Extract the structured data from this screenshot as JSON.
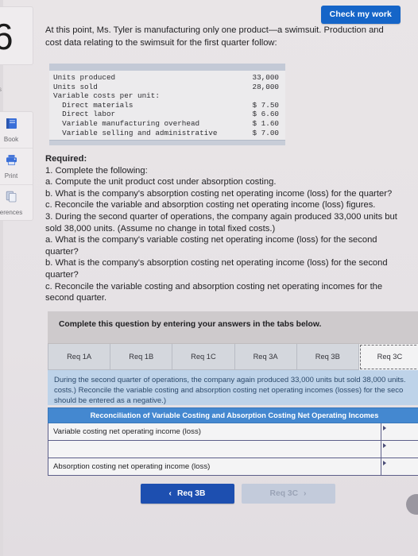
{
  "sidebar": {
    "question_number": "6",
    "question_sub": "s",
    "tools": [
      {
        "label": "Book",
        "icon": "book-icon"
      },
      {
        "label": "Print",
        "icon": "printer-icon"
      },
      {
        "label": "erences",
        "icon": "references-icon"
      }
    ]
  },
  "header": {
    "check_my_work": "Check my work"
  },
  "intro": "At this point, Ms. Tyler is manufacturing only one product—a swimsuit. Production and cost data relating to the swimsuit for the first quarter follow:",
  "data_table": {
    "rows": [
      {
        "label": "Units produced",
        "value": "33,000"
      },
      {
        "label": "Units sold",
        "value": "28,000"
      },
      {
        "label": "Variable costs per unit:",
        "value": ""
      },
      {
        "label": "  Direct materials",
        "value": "$ 7.50"
      },
      {
        "label": "  Direct labor",
        "value": "$ 6.60"
      },
      {
        "label": "  Variable manufacturing overhead",
        "value": "$ 1.60"
      },
      {
        "label": "  Variable selling and administrative",
        "value": "$ 7.00"
      }
    ]
  },
  "required": {
    "heading": "Required:",
    "lines": [
      "1. Complete the following:",
      "a. Compute the unit product cost under absorption costing.",
      "b. What is the company's absorption costing net operating income (loss) for the quarter?",
      "c. Reconcile the variable and absorption costing net operating income (loss) figures.",
      "3. During the second quarter of operations, the company again produced 33,000 units but sold 38,000 units. (Assume no change in total fixed costs.)",
      "a. What is the company's variable costing net operating income (loss) for the second quarter?",
      "b. What is the company's absorption costing net operating income (loss) for the second quarter?",
      "c. Reconcile the variable costing and absorption costing net operating incomes for the second quarter."
    ]
  },
  "panel": {
    "banner": "Complete this question by entering your answers in the tabs below.",
    "tabs": [
      {
        "label": "Req 1A",
        "active": false
      },
      {
        "label": "Req 1B",
        "active": false
      },
      {
        "label": "Req 1C",
        "active": false
      },
      {
        "label": "Req 3A",
        "active": false
      },
      {
        "label": "Req 3B",
        "active": false
      },
      {
        "label": "Req 3C",
        "active": true
      }
    ],
    "sub_instruction": "During the second quarter of operations, the company again produced 33,000 units but sold 38,000 units. costs.) Reconcile the variable costing and absorption costing net operating incomes (losses) for the seco should be entered as a negative.)",
    "recon": {
      "title": "Reconciliation of Variable Costing and Absorption Costing Net Operating Incomes",
      "rows": [
        {
          "label": "Variable costing net operating income (loss)",
          "value": ""
        },
        {
          "label": "",
          "value": ""
        },
        {
          "label": "Absorption costing net operating income (loss)",
          "value": ""
        }
      ]
    },
    "nav": {
      "prev_label": "Req 3B",
      "prev_chevron": "‹",
      "next_label": "Req 3C",
      "next_chevron": "›"
    }
  },
  "colors": {
    "accent_blue": "#1565c8",
    "table_header_blue": "#4488d0",
    "info_blue_bg": "#bed3e9",
    "nav_active": "#1d4fb0",
    "nav_disabled": "#c3cbdb"
  }
}
